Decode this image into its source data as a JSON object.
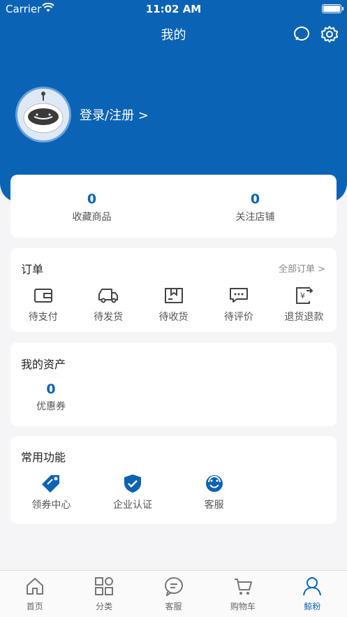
{
  "status": {
    "carrier": "Carrier",
    "time": "11:02 AM"
  },
  "nav": {
    "title": "我的"
  },
  "profile": {
    "login_label": "登录/注册 >"
  },
  "stats": [
    {
      "value": "0",
      "label": "收藏商品"
    },
    {
      "value": "0",
      "label": "关注店铺"
    }
  ],
  "orders": {
    "title": "订单",
    "all_label": "全部订单",
    "items": [
      {
        "label": "待支付",
        "icon": "wallet-icon"
      },
      {
        "label": "待发货",
        "icon": "truck-icon"
      },
      {
        "label": "待收货",
        "icon": "package-icon"
      },
      {
        "label": "待评价",
        "icon": "comment-icon"
      },
      {
        "label": "退货退款",
        "icon": "refund-icon"
      }
    ]
  },
  "assets": {
    "title": "我的资产",
    "coupon_value": "0",
    "coupon_label": "优惠券"
  },
  "functions": {
    "title": "常用功能",
    "items": [
      {
        "label": "领券中心",
        "icon": "coupon-tag-icon"
      },
      {
        "label": "企业认证",
        "icon": "shield-check-icon"
      },
      {
        "label": "客服",
        "icon": "customer-service-icon"
      }
    ]
  },
  "tabs": [
    {
      "label": "首页",
      "icon": "home-icon"
    },
    {
      "label": "分类",
      "icon": "category-icon"
    },
    {
      "label": "客服",
      "icon": "chat-icon"
    },
    {
      "label": "购物车",
      "icon": "cart-icon"
    },
    {
      "label": "鲸粉",
      "icon": "user-icon",
      "active": true
    }
  ],
  "colors": {
    "brand": "#0b63b5",
    "background": "#f5f5f7"
  }
}
